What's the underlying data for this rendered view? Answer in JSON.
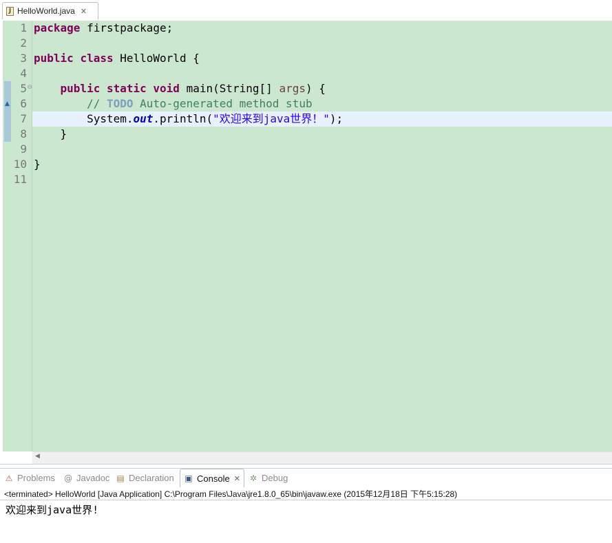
{
  "editor": {
    "tab": {
      "filename": "HelloWorld.java",
      "file_icon": "java-file-icon",
      "close_icon": "close-icon"
    },
    "line_numbers": [
      "1",
      "2",
      "3",
      "4",
      "5",
      "6",
      "7",
      "8",
      "9",
      "10",
      "11"
    ],
    "current_line": "7",
    "code": {
      "l1": {
        "kw": "package",
        "rest": " firstpackage;"
      },
      "l3": {
        "kw1": "public",
        "kw2": "class",
        "rest": " HelloWorld {"
      },
      "l5": {
        "indent": "    ",
        "kw1": "public",
        "kw2": "static",
        "kw3": "void",
        "name": " main(String[] ",
        "param": "args",
        "rest": ") {"
      },
      "l6": {
        "indent": "        ",
        "comment_start": "// ",
        "todo": "TODO",
        "comment_rest": " Auto-generated method stub"
      },
      "l7": {
        "indent": "        ",
        "obj": "System.",
        "field": "out",
        "call": ".println(",
        "string": "\"欢迎来到java世界！\"",
        "end": ");"
      },
      "l8": {
        "text": "    }"
      },
      "l10": {
        "text": "}"
      }
    },
    "colors": {
      "background": "#cce7d0",
      "current_line": "#e8f2fe",
      "keyword": "#7f0055",
      "comment": "#3f7f5f",
      "string": "#2a00ff",
      "field": "#0000c0"
    }
  },
  "views": {
    "tabs": [
      {
        "label": "Problems",
        "icon": "problems-icon"
      },
      {
        "label": "Javadoc",
        "icon": "javadoc-at-icon"
      },
      {
        "label": "Declaration",
        "icon": "declaration-icon"
      },
      {
        "label": "Console",
        "icon": "console-icon",
        "active": true
      },
      {
        "label": "Debug",
        "icon": "debug-bug-icon"
      }
    ],
    "console_close_icon": "close-icon"
  },
  "console": {
    "description": "<terminated> HelloWorld [Java Application] C:\\Program Files\\Java\\jre1.8.0_65\\bin\\javaw.exe (2015年12月18日 下午5:15:28)",
    "output": "欢迎来到java世界!"
  }
}
